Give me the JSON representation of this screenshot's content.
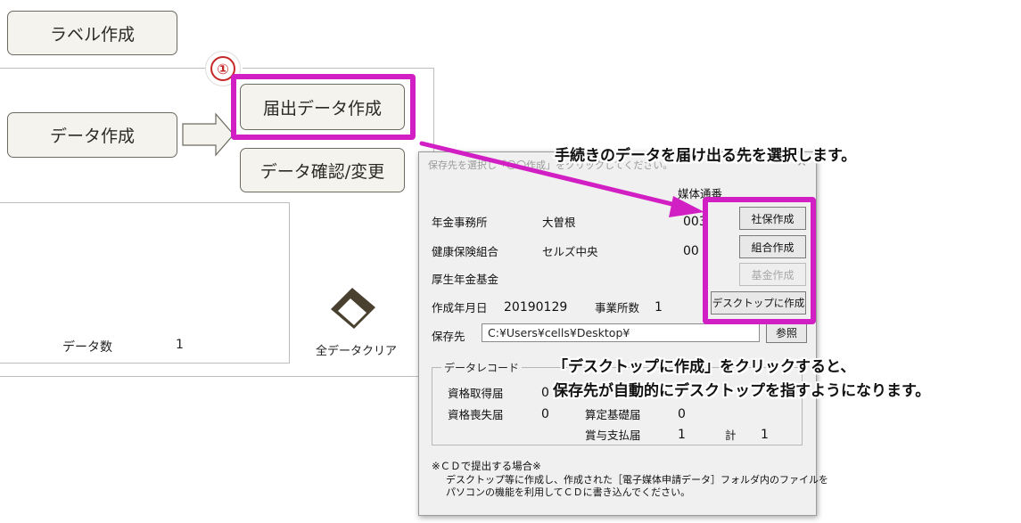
{
  "main": {
    "label_button": "ラベル作成",
    "data_button": "データ作成",
    "submit_data_button": "届出データ作成",
    "confirm_data_button": "データ確認/変更",
    "step_marker": "①",
    "data_count_label": "データ数",
    "data_count_value": "1",
    "clear_all_label": "全データクリア"
  },
  "dialog": {
    "title": "保存先を選択し「〇〇作成」をクリックしてください。",
    "close": "✕",
    "media_serial_header": "媒体通番",
    "rows": [
      {
        "label": "年金事務所",
        "value": "大曽根",
        "serial": "003"
      },
      {
        "label": "健康保険組合",
        "value": "セルズ中央",
        "serial": "00"
      },
      {
        "label": "厚生年金基金",
        "value": "",
        "serial": ""
      }
    ],
    "buttons": {
      "shaho": "社保作成",
      "kumiai": "組合作成",
      "kikin": "基金作成",
      "desktop": "デスクトップに作成",
      "browse": "参照"
    },
    "created_date_label": "作成年月日",
    "created_date_value": "20190129",
    "office_count_label": "事業所数",
    "office_count_value": "1",
    "save_dest_label": "保存先",
    "save_dest_value": "C:¥Users¥cells¥Desktop¥",
    "record_group_label": "データレコード",
    "records": {
      "acquire_label": "資格取得届",
      "acquire_value": "0",
      "loss_label": "資格喪失届",
      "loss_value": "0",
      "santei_label": "算定基礎届",
      "santei_value": "0",
      "bonus_label": "賞与支払届",
      "bonus_value": "1",
      "total_label": "計",
      "total_value": "1"
    },
    "note_title": "※ＣＤで提出する場合※",
    "note_line1": "デスクトップ等に作成し、作成された［電子媒体申請データ］フォルダ内のファイルを",
    "note_line2": "パソコンの機能を利用してＣＤに書き込んでください。"
  },
  "annotations": {
    "callout_top": "手続きのデータを届け出る先を選択します。",
    "callout_mid_1": "「デスクトップに作成」をクリックすると、",
    "callout_mid_2": "保存先が自動的にデスクトップを指すようになります。"
  },
  "colors": {
    "highlight": "#d21fc4",
    "button_bg": "#f4f3ee",
    "dialog_bg": "#f0f0f0"
  }
}
